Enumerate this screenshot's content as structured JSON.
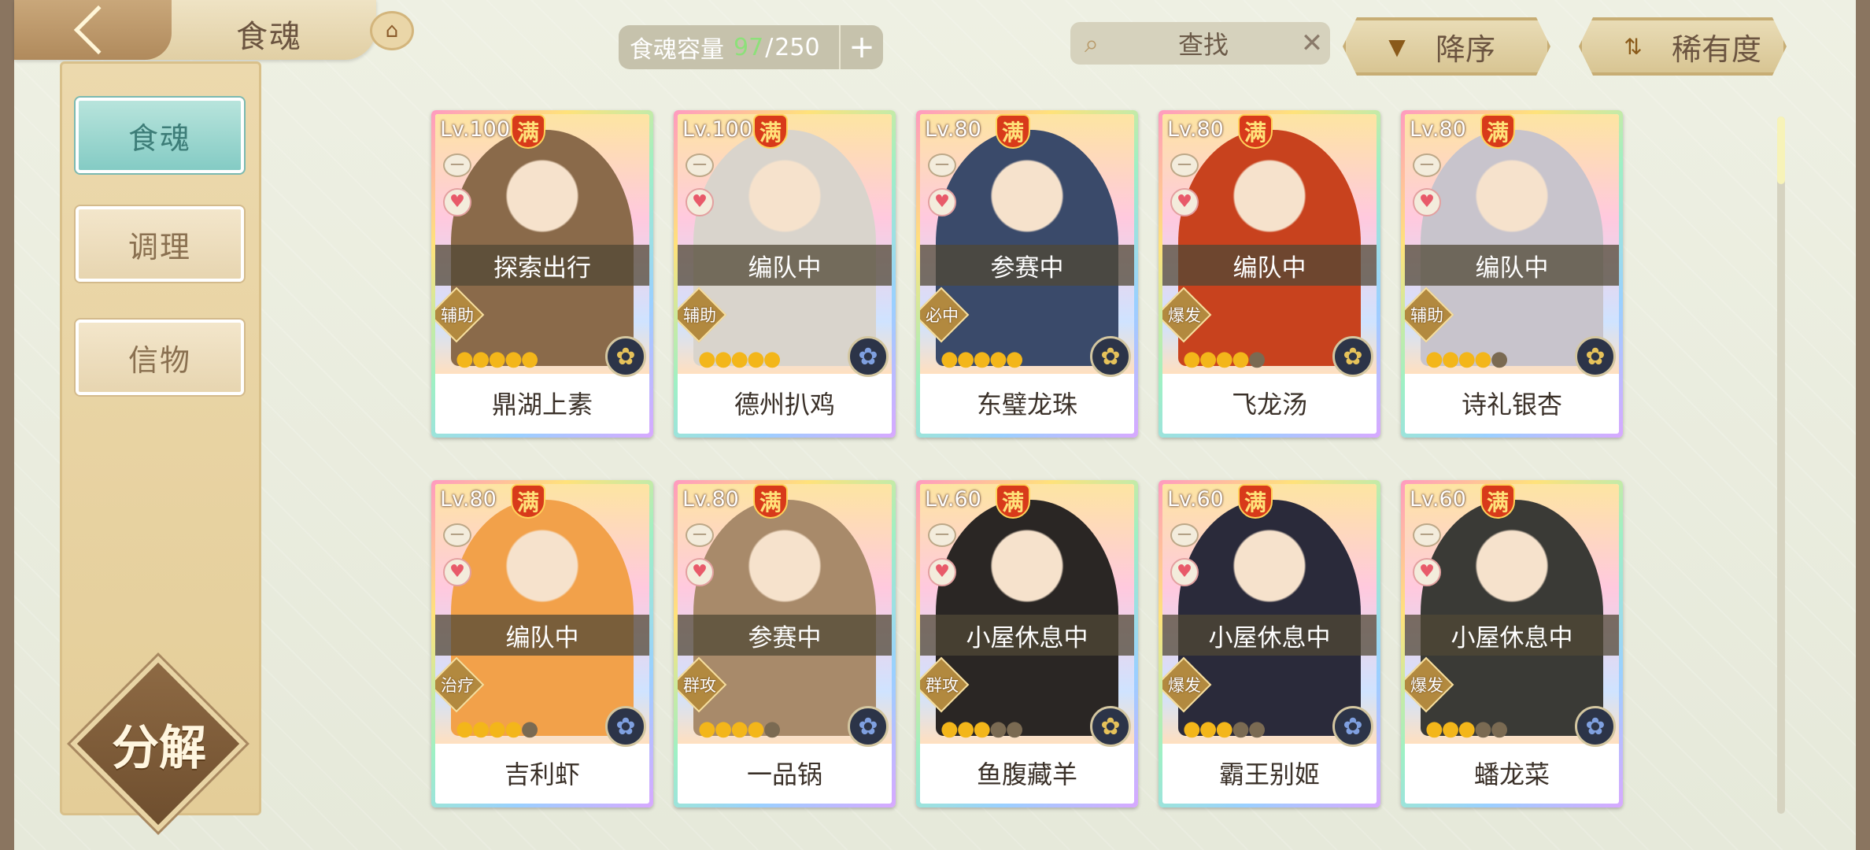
{
  "header": {
    "title": "食魂",
    "capacity_label": "食魂容量",
    "capacity_current": "97",
    "capacity_max": "250",
    "capacity_plus": "+",
    "search_placeholder": "查找",
    "search_clear": "✕",
    "sort_label": "降序",
    "rarity_label": "稀有度"
  },
  "sidebar": {
    "items": [
      {
        "label": "食魂"
      },
      {
        "label": "调理"
      },
      {
        "label": "信物"
      }
    ],
    "decompose_label": "分解"
  },
  "scroll": {
    "position": 0.0
  },
  "cards": [
    {
      "lv": "Lv.100",
      "full": "满",
      "status": "探索出行",
      "role": "辅助",
      "name": "鼎湖上素",
      "stars": 5,
      "element": "gold",
      "color": "#8a6a4a"
    },
    {
      "lv": "Lv.100",
      "full": "满",
      "status": "编队中",
      "role": "辅助",
      "name": "德州扒鸡",
      "stars": 5,
      "element": "blue",
      "color": "#d9d4cc"
    },
    {
      "lv": "Lv.80",
      "full": "满",
      "status": "参赛中",
      "role": "必中",
      "name": "东璧龙珠",
      "stars": 5,
      "element": "gold",
      "color": "#3a4a6a"
    },
    {
      "lv": "Lv.80",
      "full": "满",
      "status": "编队中",
      "role": "爆发",
      "name": "飞龙汤",
      "stars": 4,
      "element": "gold",
      "color": "#c8421e"
    },
    {
      "lv": "Lv.80",
      "full": "满",
      "status": "编队中",
      "role": "辅助",
      "name": "诗礼银杏",
      "stars": 4,
      "element": "gold",
      "color": "#c8c4cc"
    },
    {
      "lv": "Lv.80",
      "full": "满",
      "status": "编队中",
      "role": "治疗",
      "name": "吉利虾",
      "stars": 4,
      "element": "blue",
      "color": "#f2a14a"
    },
    {
      "lv": "Lv.80",
      "full": "满",
      "status": "参赛中",
      "role": "群攻",
      "name": "一品锅",
      "stars": 4,
      "element": "blue",
      "color": "#a88a6a"
    },
    {
      "lv": "Lv.60",
      "full": "满",
      "status": "小屋休息中",
      "role": "群攻",
      "name": "鱼腹藏羊",
      "stars": 3,
      "element": "gold",
      "color": "#2a2624"
    },
    {
      "lv": "Lv.60",
      "full": "满",
      "status": "小屋休息中",
      "role": "爆发",
      "name": "霸王别姬",
      "stars": 3,
      "element": "blue",
      "color": "#2a2a3a"
    },
    {
      "lv": "Lv.60",
      "full": "满",
      "status": "小屋休息中",
      "role": "爆发",
      "name": "蟠龙菜",
      "stars": 3,
      "element": "blue",
      "color": "#3a3a36"
    }
  ],
  "icons": {
    "back": "chevron-left-icon",
    "pavilion": "pavilion-icon",
    "search": "search-icon",
    "clear": "close-icon",
    "sort": "triangle-down-icon",
    "rarity": "sort-arrows-icon",
    "dash": "minus-icon",
    "heart": "heart-icon",
    "element": "flower-icon"
  }
}
